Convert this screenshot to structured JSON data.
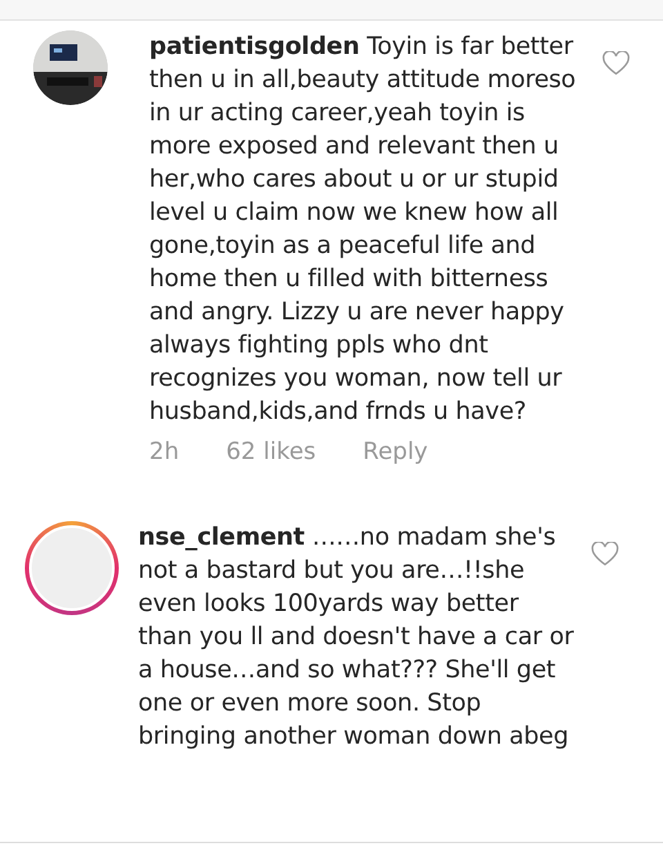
{
  "comments": [
    {
      "username": "patientisgolden",
      "text": "Toyin is far better then u in all,beauty attitude moreso in ur acting career,yeah toyin is more exposed and relevant then u her,who cares about u or ur stupid level u claim now we knew how all gone,toyin as a peaceful life and home then u filled with bitterness and angry. Lizzy u are never happy always fighting ppls who dnt recognizes you woman, now tell ur husband,kids,and frnds u have?",
      "has_photo": true,
      "story_ring": false,
      "liked": false,
      "time": "2h",
      "likes": "62 likes",
      "reply": "Reply"
    },
    {
      "username": "nse_clement",
      "text": "……no madam she's not a bastard but you are…!!she even looks 100yards way better than you ll and doesn't have a car or a house…and so what??? She'll get one or even more soon. Stop bringing another woman down abeg",
      "has_photo": false,
      "story_ring": true,
      "liked": false
    }
  ]
}
